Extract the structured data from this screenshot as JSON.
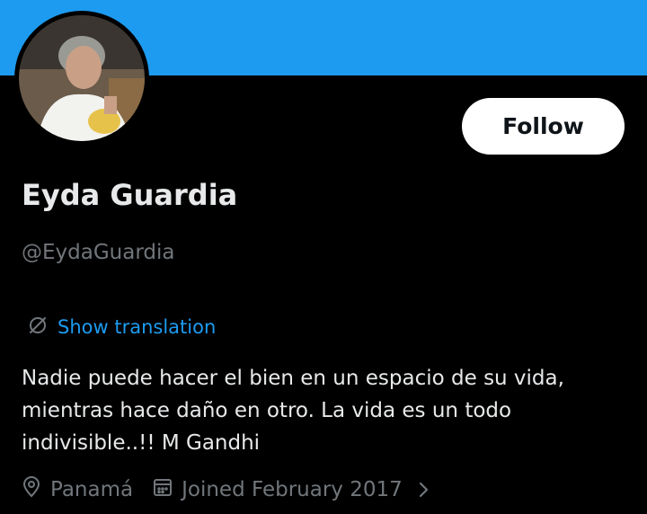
{
  "profile": {
    "name": "Eyda Guardia",
    "handle": "@EydaGuardia",
    "bio": "Nadie puede hacer el bien en un espacio de su vida, mientras hace daño en otro. La vida es un todo indivisible..!! M Gandhi",
    "location": "Panamá",
    "joined": "Joined February 2017"
  },
  "actions": {
    "follow_label": "Follow",
    "translate_label": "Show translation"
  },
  "icons": {
    "location": "location-pin-icon",
    "calendar": "calendar-icon",
    "translate": "translate-globe-icon",
    "chevron": "chevron-right-icon"
  },
  "colors": {
    "banner": "#1d9bf0",
    "background": "#000000",
    "link": "#1d9bf0",
    "secondary_text": "#71767b"
  }
}
